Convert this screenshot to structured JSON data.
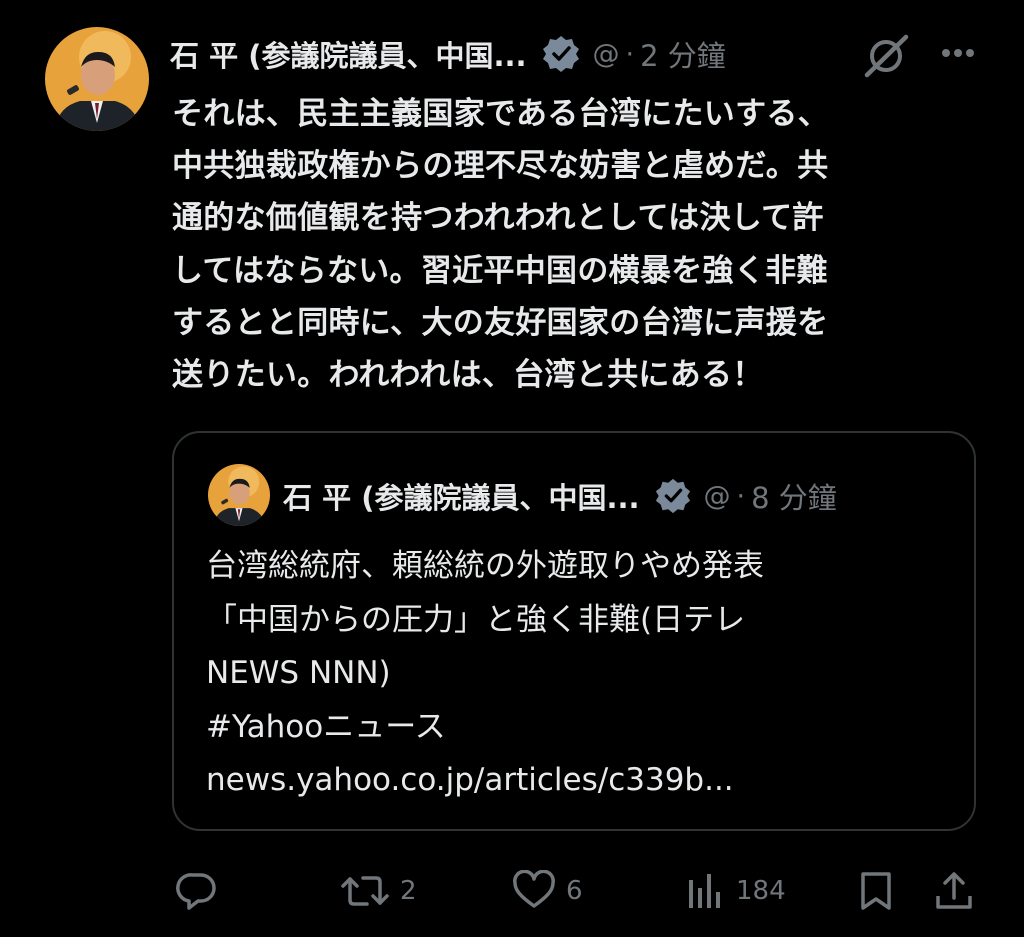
{
  "tweet": {
    "author_name": "石 平 (参議院議員、中国...",
    "time": "2 分鐘",
    "body": "それは、民主主義国家である台湾にたいする、\n中共独裁政権からの理不尽な妨害と虐めだ。共\n通的な価値観を持つわれわれとしては決して許\nしてはならない。習近平中国の横暴を強く非難\nするとと同時に、大の友好国家の台湾に声援を\n送りたい。われわれは、台湾と共にある！"
  },
  "quoted": {
    "author_name": "石 平 (参議院議員、中国...",
    "time": "8 分鐘",
    "body": "台湾総統府、頼総統の外遊取りやめ発表\n「中国からの圧力」と強く非難(日テレ\nNEWS NNN)\n#Yahooニュース\nnews.yahoo.co.jp/articles/c339b..."
  },
  "actions": {
    "replies": "",
    "reposts": "2",
    "likes": "6",
    "views": "184"
  },
  "colors": {
    "background": "#000000",
    "text": "#e7e9ea",
    "muted": "#71767b",
    "border": "#2f3336",
    "verified_badge": "#7b8a9a"
  },
  "icons": [
    "avatar",
    "verified-badge-icon",
    "grok-icon",
    "more-icon",
    "reply-icon",
    "repost-icon",
    "like-icon",
    "views-icon",
    "bookmark-icon",
    "share-icon"
  ]
}
